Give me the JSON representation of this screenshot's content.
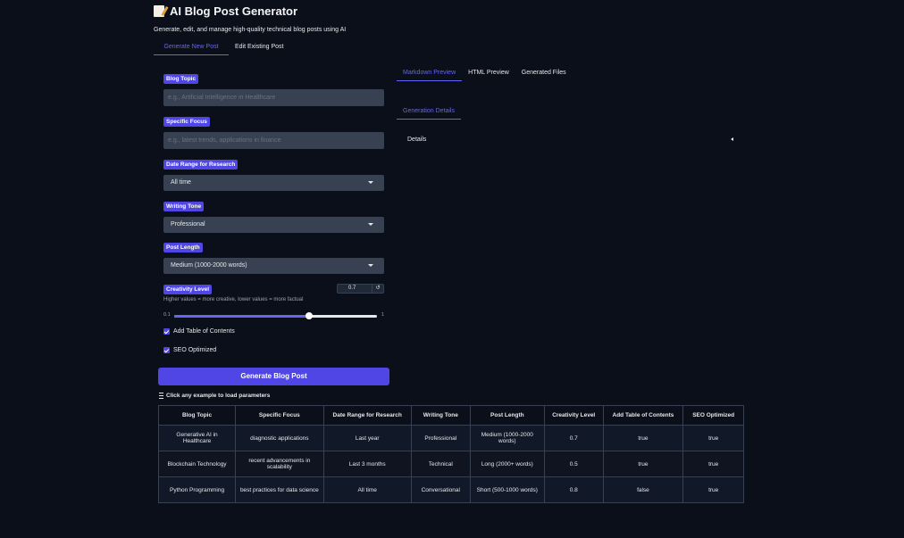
{
  "app": {
    "title": "AI Blog Post Generator",
    "subtitle": "Generate, edit, and manage high-quality technical blog posts using AI"
  },
  "main_tabs": [
    {
      "label": "Generate New Post",
      "active": true
    },
    {
      "label": "Edit Existing Post",
      "active": false
    }
  ],
  "form": {
    "blog_topic": {
      "label": "Blog Topic",
      "placeholder": "e.g., Artificial Intelligence in Healthcare",
      "value": ""
    },
    "specific_focus": {
      "label": "Specific Focus",
      "placeholder": "e.g., latest trends, applications in finance",
      "value": ""
    },
    "date_range": {
      "label": "Date Range for Research",
      "value": "All time"
    },
    "writing_tone": {
      "label": "Writing Tone",
      "value": "Professional"
    },
    "post_length": {
      "label": "Post Length",
      "value": "Medium (1000-2000 words)"
    },
    "creativity": {
      "label": "Creativity Level",
      "value": "0.7",
      "min": "0.1",
      "max": "1",
      "fill_fraction": 0.667,
      "hint": "Higher values = more creative, lower values = more factual",
      "reset_icon": "reset-icon"
    },
    "add_toc": {
      "label": "Add Table of Contents",
      "checked": true
    },
    "seo_optimized": {
      "label": "SEO Optimized",
      "checked": true
    },
    "generate_button": "Generate Blog Post"
  },
  "examples": {
    "title": "Click any example to load parameters",
    "columns": [
      "Blog Topic",
      "Specific Focus",
      "Date Range for Research",
      "Writing Tone",
      "Post Length",
      "Creativity Level",
      "Add Table of Contents",
      "SEO Optimized"
    ],
    "rows": [
      [
        "Generative AI in Healthcare",
        "diagnostic applications",
        "Last year",
        "Professional",
        "Medium (1000-2000 words)",
        "0.7",
        "true",
        "true"
      ],
      [
        "Blockchain Technology",
        "recent advancements in scalability",
        "Last 3 months",
        "Technical",
        "Long (2000+ words)",
        "0.5",
        "true",
        "true"
      ],
      [
        "Python Programming",
        "best practices for data science",
        "All time",
        "Conversational",
        "Short (500-1000 words)",
        "0.8",
        "false",
        "true"
      ]
    ]
  },
  "output_tabs": [
    {
      "label": "Markdown Preview",
      "active": true
    },
    {
      "label": "HTML Preview",
      "active": false
    },
    {
      "label": "Generated Files",
      "active": false
    }
  ],
  "details_tab": {
    "label": "Generation Details"
  },
  "details": {
    "label": "Details"
  },
  "colors": {
    "background": "#0b0f19",
    "accent": "#4f46e5",
    "accent_text": "#6366f1",
    "input_bg": "#374151"
  }
}
